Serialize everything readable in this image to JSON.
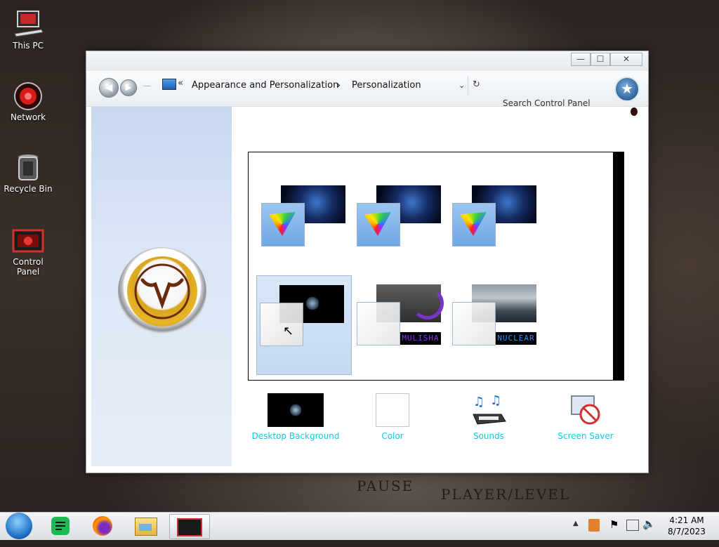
{
  "desktop": {
    "icons": [
      {
        "label": "This PC",
        "icon": "computer-icon"
      },
      {
        "label": "Network",
        "icon": "network-icon"
      },
      {
        "label": "Recycle Bin",
        "icon": "recycle-bin-icon"
      },
      {
        "label": "Control Panel",
        "icon": "control-panel-icon"
      }
    ],
    "wallpaper_text": [
      "PAUSE",
      "PLAYER/LEVEL"
    ]
  },
  "window": {
    "controls": {
      "minimize": "—",
      "maximize": "☐",
      "close": "✕"
    },
    "breadcrumb": {
      "overflow": "«",
      "items": [
        "Appearance and Personalization",
        "Personalization"
      ],
      "separator": "›"
    },
    "search": {
      "placeholder": "Search Control Panel"
    },
    "left_pane": {
      "links": [
        "",
        "",
        ""
      ],
      "see_also_title": "",
      "see_also": [
        "",
        "",
        ""
      ]
    },
    "header": {
      "title": "",
      "subtitle": ""
    },
    "themes": [
      {
        "name": "",
        "wallpaper": "space",
        "swatch": "fan",
        "badge": ""
      },
      {
        "name": "",
        "wallpaper": "space",
        "swatch": "fan",
        "badge": ""
      },
      {
        "name": "",
        "wallpaper": "space",
        "swatch": "fan",
        "badge": ""
      },
      {
        "name": "",
        "wallpaper": "dark",
        "swatch": "light",
        "badge": "",
        "selected": true
      },
      {
        "name": "",
        "wallpaper": "gray",
        "swatch": "light",
        "badge": "MULISHA"
      },
      {
        "name": "",
        "wallpaper": "cloud",
        "swatch": "light",
        "badge": "NUCLEAR"
      }
    ],
    "shortcuts": [
      {
        "label": "Desktop Background",
        "icon": "desktop-background-icon"
      },
      {
        "label": "Color",
        "icon": "color-icon"
      },
      {
        "label": "Sounds",
        "icon": "sounds-icon"
      },
      {
        "label": "Screen Saver",
        "icon": "screen-saver-icon"
      }
    ]
  },
  "taskbar": {
    "pinned": [
      "start-orb-icon",
      "notes-app-icon",
      "firefox-icon",
      "file-explorer-icon",
      "control-panel-icon"
    ],
    "tray": {
      "time": "4:21 AM",
      "date": "8/7/2023"
    }
  },
  "colors": {
    "link": "#13c8e2",
    "selected_tile": "#c4d9f1",
    "left_pane": "#c7d8f0"
  }
}
